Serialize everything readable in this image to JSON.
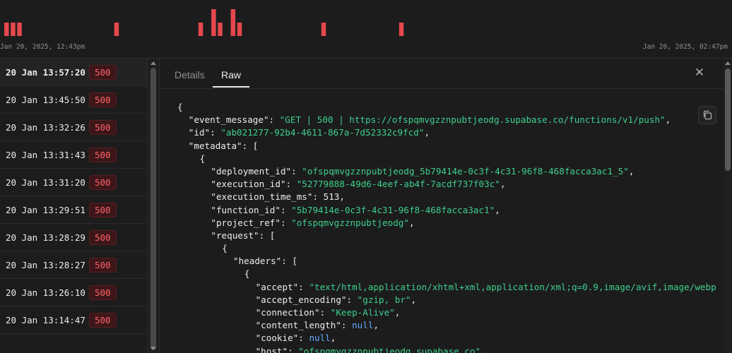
{
  "histogram": {
    "start_label": "Jan 20, 2025, 12:43pm",
    "end_label": "Jan 20, 2025, 02:47pm",
    "bar_color": "#e5484d",
    "values": [
      1,
      1,
      1,
      0,
      0,
      0,
      0,
      0,
      0,
      0,
      0,
      0,
      0,
      0,
      0,
      0,
      0,
      1,
      0,
      0,
      0,
      0,
      0,
      0,
      0,
      0,
      0,
      0,
      0,
      0,
      1,
      0,
      2,
      1,
      0,
      2,
      1,
      0,
      0,
      0,
      0,
      0,
      0,
      0,
      0,
      0,
      0,
      0,
      0,
      1,
      0,
      0,
      0,
      0,
      0,
      0,
      0,
      0,
      0,
      0,
      0,
      1,
      0,
      0,
      0,
      0,
      0,
      0,
      0,
      0,
      0,
      0,
      0,
      0,
      0,
      0,
      0,
      0,
      0,
      0,
      0,
      0,
      0,
      0,
      0,
      0,
      0,
      0,
      0,
      0,
      0,
      0,
      0,
      0,
      0,
      0,
      0,
      0,
      0,
      0,
      0,
      0,
      0,
      0,
      0,
      0,
      0,
      0,
      0,
      0,
      0,
      0,
      0,
      0
    ]
  },
  "logs": [
    {
      "time": "20 Jan 13:57:20",
      "status": "500",
      "selected": true
    },
    {
      "time": "20 Jan 13:45:50",
      "status": "500"
    },
    {
      "time": "20 Jan 13:32:26",
      "status": "500"
    },
    {
      "time": "20 Jan 13:31:43",
      "status": "500"
    },
    {
      "time": "20 Jan 13:31:20",
      "status": "500"
    },
    {
      "time": "20 Jan 13:29:51",
      "status": "500"
    },
    {
      "time": "20 Jan 13:28:29",
      "status": "500"
    },
    {
      "time": "20 Jan 13:28:27",
      "status": "500"
    },
    {
      "time": "20 Jan 13:26:10",
      "status": "500"
    },
    {
      "time": "20 Jan 13:14:47",
      "status": "500"
    }
  ],
  "detail": {
    "tabs": {
      "details": "Details",
      "raw": "Raw"
    },
    "active_tab": "raw",
    "close_icon": "close-icon",
    "copy_icon": "copy-icon",
    "json_lines": [
      {
        "indent": 0,
        "parts": [
          [
            "p",
            "{"
          ]
        ]
      },
      {
        "indent": 1,
        "parts": [
          [
            "k",
            "\"event_message\""
          ],
          [
            "p",
            ": "
          ],
          [
            "s",
            "\"GET | 500 | https://ofspqmvgzznpubtjeodg.supabase.co/functions/v1/push\""
          ],
          [
            "p",
            ","
          ]
        ]
      },
      {
        "indent": 1,
        "parts": [
          [
            "k",
            "\"id\""
          ],
          [
            "p",
            ": "
          ],
          [
            "s",
            "\"ab021277-92b4-4611-867a-7d52332c9fcd\""
          ],
          [
            "p",
            ","
          ]
        ]
      },
      {
        "indent": 1,
        "parts": [
          [
            "k",
            "\"metadata\""
          ],
          [
            "p",
            ": ["
          ]
        ]
      },
      {
        "indent": 2,
        "parts": [
          [
            "p",
            "{"
          ]
        ]
      },
      {
        "indent": 3,
        "parts": [
          [
            "k",
            "\"deployment_id\""
          ],
          [
            "p",
            ": "
          ],
          [
            "s",
            "\"ofspqmvgzznpubtjeodg_5b79414e-0c3f-4c31-96f8-468facca3ac1_5\""
          ],
          [
            "p",
            ","
          ]
        ]
      },
      {
        "indent": 3,
        "parts": [
          [
            "k",
            "\"execution_id\""
          ],
          [
            "p",
            ": "
          ],
          [
            "s",
            "\"52779888-49d6-4eef-ab4f-7acdf737f03c\""
          ],
          [
            "p",
            ","
          ]
        ]
      },
      {
        "indent": 3,
        "parts": [
          [
            "k",
            "\"execution_time_ms\""
          ],
          [
            "p",
            ": "
          ],
          [
            "n",
            "513"
          ],
          [
            "p",
            ","
          ]
        ]
      },
      {
        "indent": 3,
        "parts": [
          [
            "k",
            "\"function_id\""
          ],
          [
            "p",
            ": "
          ],
          [
            "s",
            "\"5b79414e-0c3f-4c31-96f8-468facca3ac1\""
          ],
          [
            "p",
            ","
          ]
        ]
      },
      {
        "indent": 3,
        "parts": [
          [
            "k",
            "\"project_ref\""
          ],
          [
            "p",
            ": "
          ],
          [
            "s",
            "\"ofspqmvgzznpubtjeodg\""
          ],
          [
            "p",
            ","
          ]
        ]
      },
      {
        "indent": 3,
        "parts": [
          [
            "k",
            "\"request\""
          ],
          [
            "p",
            ": ["
          ]
        ]
      },
      {
        "indent": 4,
        "parts": [
          [
            "p",
            "{"
          ]
        ]
      },
      {
        "indent": 5,
        "parts": [
          [
            "k",
            "\"headers\""
          ],
          [
            "p",
            ": ["
          ]
        ]
      },
      {
        "indent": 6,
        "parts": [
          [
            "p",
            "{"
          ]
        ]
      },
      {
        "indent": 7,
        "parts": [
          [
            "k",
            "\"accept\""
          ],
          [
            "p",
            ": "
          ],
          [
            "s",
            "\"text/html,application/xhtml+xml,application/xml;q=0.9,image/avif,image/webp"
          ]
        ]
      },
      {
        "indent": 7,
        "parts": [
          [
            "k",
            "\"accept_encoding\""
          ],
          [
            "p",
            ": "
          ],
          [
            "s",
            "\"gzip, br\""
          ],
          [
            "p",
            ","
          ]
        ]
      },
      {
        "indent": 7,
        "parts": [
          [
            "k",
            "\"connection\""
          ],
          [
            "p",
            ": "
          ],
          [
            "s",
            "\"Keep-Alive\""
          ],
          [
            "p",
            ","
          ]
        ]
      },
      {
        "indent": 7,
        "parts": [
          [
            "k",
            "\"content_length\""
          ],
          [
            "p",
            ": "
          ],
          [
            "nl",
            "null"
          ],
          [
            "p",
            ","
          ]
        ]
      },
      {
        "indent": 7,
        "parts": [
          [
            "k",
            "\"cookie\""
          ],
          [
            "p",
            ": "
          ],
          [
            "nl",
            "null"
          ],
          [
            "p",
            ","
          ]
        ]
      },
      {
        "indent": 7,
        "parts": [
          [
            "k",
            "\"host\""
          ],
          [
            "p",
            ": "
          ],
          [
            "s",
            "\"ofspqmvgzznpubtjeodg.supabase.co\""
          ],
          [
            "p",
            ","
          ]
        ]
      }
    ]
  }
}
